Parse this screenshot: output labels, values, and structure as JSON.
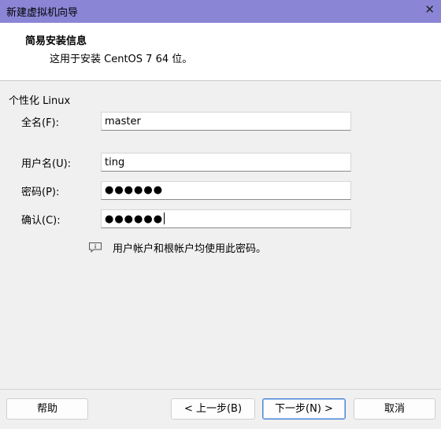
{
  "window": {
    "title": "新建虚拟机向导",
    "close_glyph": "✕"
  },
  "header": {
    "title": "简易安装信息",
    "subtitle": "这用于安装 CentOS 7 64 位。"
  },
  "form": {
    "group_label": "个性化 Linux",
    "fullname": {
      "label": "全名(F):",
      "value": "master"
    },
    "username": {
      "label": "用户名(U):",
      "value": "ting"
    },
    "password": {
      "label": "密码(P):",
      "value": "●●●●●●"
    },
    "confirm": {
      "label": "确认(C):",
      "value": "●●●●●●"
    },
    "hint": "用户帐户和根帐户均使用此密码。"
  },
  "icons": {
    "hint": "speech-bubble-info-icon"
  },
  "buttons": {
    "help": "帮助",
    "back": "< 上一步(B)",
    "next": "下一步(N) >",
    "cancel": "取消"
  }
}
